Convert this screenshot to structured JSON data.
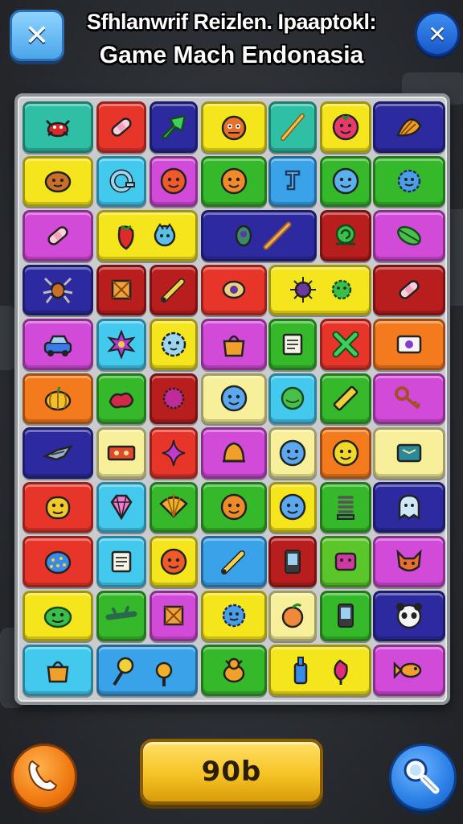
{
  "header": {
    "title_line1": "Sfhlanwrif Reizlen. Ipaaptokl:",
    "title_line2": "Game Mach Endonasia"
  },
  "buttons": {
    "close_left_icon": "close-icon",
    "close_right_icon": "close-icon",
    "close_glyph": "✕",
    "bottom_left_icon": "phone-icon",
    "bottom_right_icon": "search-icon"
  },
  "score": {
    "value": "90b"
  },
  "colors": {
    "red": "#e8352a",
    "green": "#35b82a",
    "blue": "#3aa2e8",
    "yellow": "#f5e51c",
    "magenta": "#d24ad8",
    "navy": "#2c2a9e",
    "orange": "#f47a1e",
    "cream": "#f7ef9a",
    "teal": "#2fbfa4",
    "darkred": "#b81e1e",
    "cyan": "#43c9ee",
    "lime": "#5ac62a"
  },
  "board": {
    "rows": [
      [
        {
          "color": "teal",
          "span": 1,
          "icon": "crab"
        },
        {
          "color": "red",
          "span": 1,
          "icon": "bandage"
        },
        {
          "color": "navy",
          "span": 1,
          "icon": "leaf-arrow"
        },
        {
          "color": "yellow",
          "span": 1,
          "icon": "monster-face"
        },
        {
          "color": "teal",
          "span": 1,
          "icon": "bat"
        },
        {
          "color": "yellow",
          "span": 1,
          "icon": "berry"
        },
        {
          "color": "navy",
          "span": 1,
          "icon": "shell"
        }
      ],
      [
        {
          "color": "yellow",
          "span": 1,
          "icon": "cookie-face"
        },
        {
          "color": "cyan",
          "span": 1,
          "icon": "ring"
        },
        {
          "color": "magenta",
          "span": 1,
          "icon": "tomato-face"
        },
        {
          "color": "green",
          "span": 1,
          "icon": "orange-face"
        },
        {
          "color": "blue",
          "span": 1,
          "icon": "hook"
        },
        {
          "color": "green",
          "span": 1,
          "icon": "blue-blob"
        },
        {
          "color": "green",
          "span": 1,
          "icon": "spiky-blob"
        }
      ],
      [
        {
          "color": "magenta",
          "span": 1,
          "icon": "bandage"
        },
        {
          "color": "yellow",
          "span": 2,
          "icon": "strawberry-cat"
        },
        {
          "color": "navy",
          "span": 2,
          "icon": "peacock-pen"
        },
        {
          "color": "darkred",
          "span": 1,
          "icon": "snail"
        },
        {
          "color": "magenta",
          "span": 1,
          "icon": "leaf"
        }
      ],
      [
        {
          "color": "navy",
          "span": 1,
          "icon": "bug"
        },
        {
          "color": "darkred",
          "span": 1,
          "icon": "crate"
        },
        {
          "color": "darkred",
          "span": 1,
          "icon": "pencil"
        },
        {
          "color": "red",
          "span": 1,
          "icon": "eye"
        },
        {
          "color": "yellow",
          "span": 2,
          "icon": "urchins"
        },
        {
          "color": "darkred",
          "span": 1,
          "icon": "bandage"
        }
      ],
      [
        {
          "color": "magenta",
          "span": 1,
          "icon": "car"
        },
        {
          "color": "cyan",
          "span": 1,
          "icon": "star-flower"
        },
        {
          "color": "yellow",
          "span": 1,
          "icon": "fluffy-face"
        },
        {
          "color": "magenta",
          "span": 1,
          "icon": "bag"
        },
        {
          "color": "green",
          "span": 1,
          "icon": "note"
        },
        {
          "color": "red",
          "span": 1,
          "icon": "cross"
        },
        {
          "color": "orange",
          "span": 1,
          "icon": "tv"
        }
      ],
      [
        {
          "color": "orange",
          "span": 1,
          "icon": "pumpkin"
        },
        {
          "color": "green",
          "span": 1,
          "icon": "splat"
        },
        {
          "color": "darkred",
          "span": 1,
          "icon": "spiky-ball"
        },
        {
          "color": "cream",
          "span": 1,
          "icon": "blue-face"
        },
        {
          "color": "cyan",
          "span": 1,
          "icon": "green-ball"
        },
        {
          "color": "green",
          "span": 1,
          "icon": "ruler"
        },
        {
          "color": "magenta",
          "span": 1,
          "icon": "key"
        }
      ],
      [
        {
          "color": "navy",
          "span": 1,
          "icon": "bird"
        },
        {
          "color": "cream",
          "span": 1,
          "icon": "ticket"
        },
        {
          "color": "red",
          "span": 1,
          "icon": "sparkle"
        },
        {
          "color": "magenta",
          "span": 1,
          "icon": "bell"
        },
        {
          "color": "cream",
          "span": 1,
          "icon": "blue-face"
        },
        {
          "color": "orange",
          "span": 1,
          "icon": "yellow-face"
        },
        {
          "color": "cream",
          "span": 1,
          "icon": "box"
        }
      ],
      [
        {
          "color": "red",
          "span": 1,
          "icon": "yellow-monster"
        },
        {
          "color": "cyan",
          "span": 1,
          "icon": "gem"
        },
        {
          "color": "green",
          "span": 1,
          "icon": "shell-fan"
        },
        {
          "color": "green",
          "span": 1,
          "icon": "orange-face"
        },
        {
          "color": "yellow",
          "span": 1,
          "icon": "blue-face"
        },
        {
          "color": "green",
          "span": 1,
          "icon": "spring"
        },
        {
          "color": "navy",
          "span": 1,
          "icon": "ghost"
        }
      ],
      [
        {
          "color": "red",
          "span": 1,
          "icon": "dotted-blob"
        },
        {
          "color": "cyan",
          "span": 1,
          "icon": "note"
        },
        {
          "color": "yellow",
          "span": 1,
          "icon": "tomato-face"
        },
        {
          "color": "blue",
          "span": 1,
          "icon": "pencil"
        },
        {
          "color": "darkred",
          "span": 1,
          "icon": "phone"
        },
        {
          "color": "lime",
          "span": 1,
          "icon": "box-face"
        },
        {
          "color": "magenta",
          "span": 1,
          "icon": "fox"
        }
      ],
      [
        {
          "color": "yellow",
          "span": 1,
          "icon": "green-monster"
        },
        {
          "color": "green",
          "span": 1,
          "icon": "twig"
        },
        {
          "color": "magenta",
          "span": 1,
          "icon": "crate"
        },
        {
          "color": "yellow",
          "span": 1,
          "icon": "spiky-blob"
        },
        {
          "color": "cream",
          "span": 1,
          "icon": "peach"
        },
        {
          "color": "green",
          "span": 1,
          "icon": "phone"
        },
        {
          "color": "navy",
          "span": 1,
          "icon": "panda"
        }
      ],
      [
        {
          "color": "cyan",
          "span": 1,
          "icon": "bag"
        },
        {
          "color": "blue",
          "span": 2,
          "icon": "lollipops"
        },
        {
          "color": "green",
          "span": 1,
          "icon": "duck"
        },
        {
          "color": "yellow",
          "span": 2,
          "icon": "bottles"
        },
        {
          "color": "magenta",
          "span": 1,
          "icon": "fish"
        }
      ]
    ]
  }
}
